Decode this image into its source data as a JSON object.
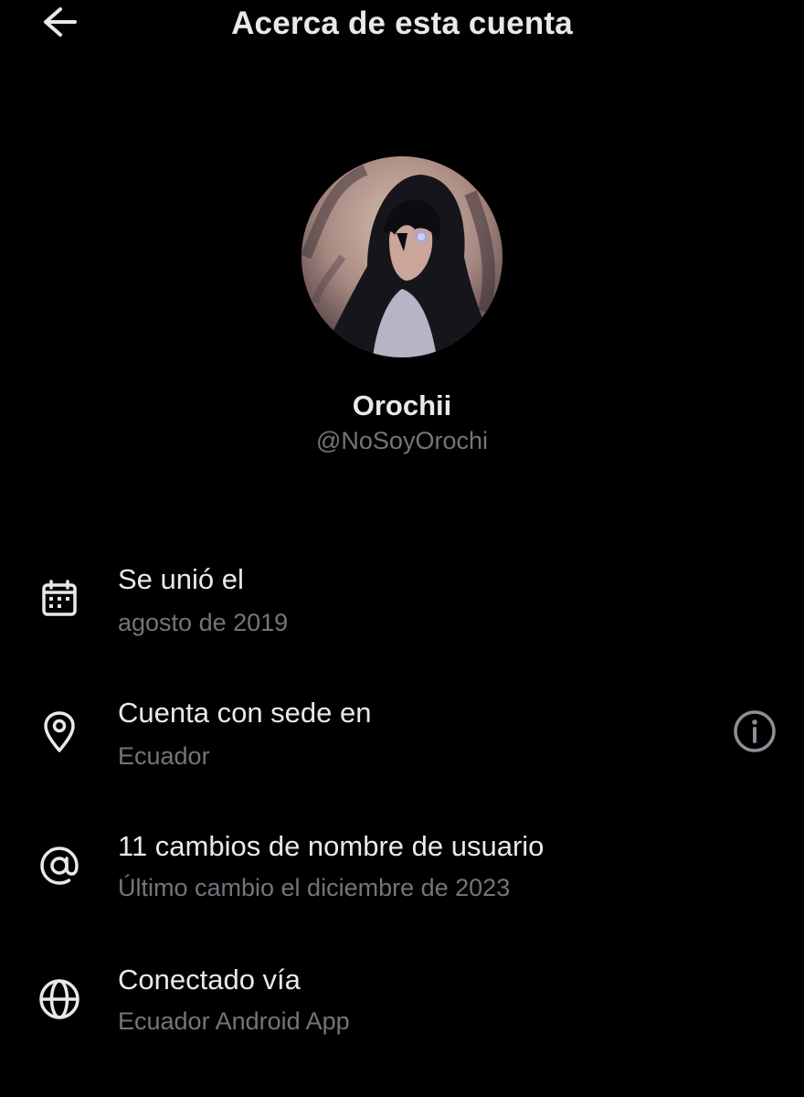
{
  "header": {
    "title": "Acerca de esta cuenta",
    "back_icon": "arrow-left-icon"
  },
  "profile": {
    "display_name": "Orochii",
    "handle": "@NoSoyOrochi",
    "avatar": "hooded-anime-character-avatar"
  },
  "details": [
    {
      "icon": "calendar-icon",
      "label": "Se unió el",
      "value": "agosto de 2019"
    },
    {
      "icon": "location-pin-icon",
      "label": "Cuenta con sede en",
      "value": "Ecuador",
      "action_icon": "info-icon"
    },
    {
      "icon": "at-sign-icon",
      "label": "11 cambios de nombre de usuario",
      "value": "Último cambio el diciembre de 2023"
    },
    {
      "icon": "globe-icon",
      "label": "Conectado vía",
      "value": "Ecuador Android App"
    }
  ],
  "colors": {
    "background": "#000000",
    "primary_text": "#e7e9ea",
    "secondary_text": "#71767b"
  }
}
